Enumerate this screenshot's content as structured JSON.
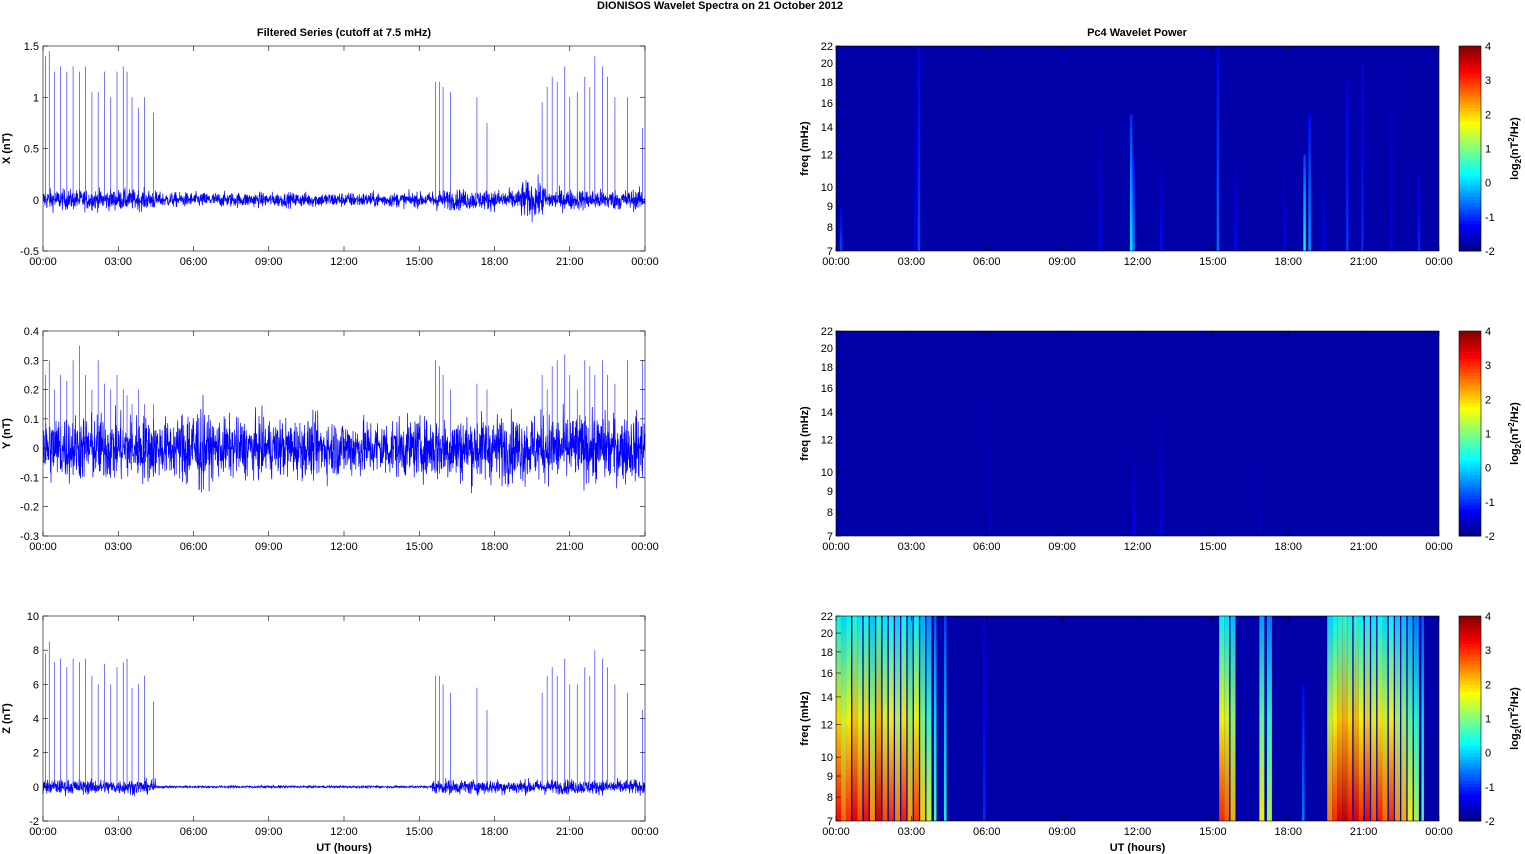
{
  "chart_data": {
    "title": "DIONISOS Wavelet Spectra on 21 October   2012",
    "left_title": "Filtered Series (cutoff at 7.5 mHz)",
    "right_title": "Pc4 Wavelet Power",
    "xlabel": "UT (hours)",
    "x_ticks": [
      "00:00",
      "03:00",
      "06:00",
      "09:00",
      "12:00",
      "15:00",
      "18:00",
      "21:00",
      "00:00"
    ],
    "xlim": [
      0,
      24
    ],
    "spike_times": [
      0.1,
      0.25,
      0.45,
      0.7,
      0.95,
      1.2,
      1.45,
      1.7,
      1.95,
      2.2,
      2.45,
      2.7,
      2.95,
      3.2,
      3.35,
      3.55,
      3.8,
      4.05,
      4.4,
      15.65,
      15.8,
      15.95,
      16.25,
      17.3,
      17.7,
      19.9,
      20.1,
      20.3,
      20.5,
      20.8,
      21.0,
      21.3,
      21.6,
      21.8,
      22.0,
      22.3,
      22.5,
      22.8,
      23.3,
      23.9
    ],
    "series": [
      {
        "type": "line",
        "name": "X",
        "ylabel": "X (nT)",
        "ylim": [
          -0.5,
          1.5
        ],
        "yticks": [
          "1.5",
          "1",
          "0.5",
          "0",
          "-0.5"
        ],
        "ytick_values": [
          1.5,
          1,
          0.5,
          0,
          -0.5
        ],
        "noise": 0.07,
        "quiet_noise": 0.05,
        "spike_amps": [
          1.4,
          1.45,
          1.25,
          1.3,
          1.25,
          1.3,
          1.25,
          1.3,
          1.05,
          1.05,
          1.25,
          1.0,
          1.25,
          1.3,
          1.25,
          1.0,
          0.9,
          1.0,
          0.85,
          1.15,
          1.15,
          1.1,
          1.05,
          1.0,
          0.75,
          0.95,
          1.1,
          1.2,
          1.15,
          1.3,
          1.0,
          1.05,
          1.2,
          1.1,
          1.4,
          1.3,
          1.2,
          1.0,
          1.0,
          0.7
        ]
      },
      {
        "type": "line",
        "name": "Y",
        "ylabel": "Y (nT)",
        "ylim": [
          -0.3,
          0.4
        ],
        "yticks": [
          "0.4",
          "0.3",
          "0.2",
          "0.1",
          "0",
          "-0.1",
          "-0.2",
          "-0.3"
        ],
        "ytick_values": [
          0.4,
          0.3,
          0.2,
          0.1,
          0,
          -0.1,
          -0.2,
          -0.3
        ],
        "noise": 0.08,
        "quiet_noise": 0.07,
        "spike_amps": [
          0.25,
          0.3,
          0.2,
          0.25,
          0.23,
          0.3,
          0.35,
          0.25,
          0.2,
          0.3,
          0.22,
          0.2,
          0.25,
          0.2,
          0.18,
          0.15,
          0.2,
          0.15,
          0.15,
          0.3,
          0.28,
          0.25,
          0.2,
          0.22,
          0.2,
          0.25,
          0.2,
          0.28,
          0.3,
          0.32,
          0.25,
          0.2,
          0.3,
          0.28,
          0.25,
          0.3,
          0.25,
          0.22,
          0.3,
          0.3
        ]
      },
      {
        "type": "line",
        "name": "Z",
        "ylabel": "Z (nT)",
        "ylim": [
          -2,
          10
        ],
        "yticks": [
          "10",
          "8",
          "6",
          "4",
          "2",
          "0",
          "-2"
        ],
        "ytick_values": [
          10,
          8,
          6,
          4,
          2,
          0,
          -2
        ],
        "noise": 0.3,
        "quiet_noise": 0.05,
        "spike_amps": [
          7.8,
          8.5,
          7.3,
          7.5,
          7.0,
          7.5,
          7.3,
          7.5,
          6.5,
          6.0,
          7.2,
          6.0,
          7.0,
          7.3,
          7.5,
          5.8,
          6.0,
          6.5,
          5.0,
          6.5,
          6.5,
          6.0,
          5.5,
          5.8,
          4.5,
          5.5,
          6.5,
          7.0,
          6.5,
          7.5,
          6.0,
          6.0,
          7.0,
          6.5,
          8.0,
          7.5,
          7.0,
          6.0,
          5.5,
          4.5
        ]
      }
    ],
    "spectra": [
      {
        "type": "heatmap",
        "ylabel": "freq (mHz)",
        "ylim": [
          7,
          22
        ],
        "yticks": [
          7,
          8,
          9,
          10,
          12,
          14,
          16,
          18,
          20,
          22
        ],
        "events": [
          [
            0.2,
            -0.8,
            9
          ],
          [
            3.3,
            -0.8,
            22
          ],
          [
            3.15,
            -1.4,
            22
          ],
          [
            10.5,
            -1.3,
            14
          ],
          [
            11.75,
            0.2,
            15
          ],
          [
            11.85,
            -0.6,
            12
          ],
          [
            12.95,
            -1.2,
            11
          ],
          [
            15.2,
            -0.6,
            22
          ],
          [
            15.9,
            -1.2,
            11
          ],
          [
            17.85,
            -1.3,
            11
          ],
          [
            18.65,
            0.4,
            12
          ],
          [
            18.85,
            -0.3,
            15
          ],
          [
            19.4,
            -1.3,
            11
          ],
          [
            20.35,
            -0.9,
            18
          ],
          [
            20.95,
            -1.0,
            20
          ],
          [
            22.1,
            -1.4,
            20
          ],
          [
            23.2,
            -1.0,
            11
          ]
        ]
      },
      {
        "type": "heatmap",
        "ylabel": "freq (mHz)",
        "ylim": [
          7,
          22
        ],
        "yticks": [
          7,
          8,
          9,
          10,
          12,
          14,
          16,
          18,
          20,
          22
        ],
        "events": [
          [
            6.1,
            -1.6,
            17
          ],
          [
            11.85,
            -1.3,
            11
          ],
          [
            12.95,
            -1.4,
            14
          ],
          [
            16.9,
            -1.6,
            11
          ]
        ]
      },
      {
        "type": "heatmap",
        "ylabel": "freq (mHz)",
        "ylim": [
          7,
          22
        ],
        "yticks": [
          7,
          8,
          9,
          10,
          12,
          14,
          16,
          18,
          20,
          22
        ],
        "events": [
          [
            0.1,
            3.2,
            22
          ],
          [
            0.3,
            2.6,
            22
          ],
          [
            0.5,
            3.0,
            22
          ],
          [
            0.75,
            3.4,
            22
          ],
          [
            0.95,
            2.8,
            22
          ],
          [
            1.2,
            3.2,
            22
          ],
          [
            1.45,
            2.4,
            22
          ],
          [
            1.7,
            3.5,
            22
          ],
          [
            1.95,
            2.8,
            22
          ],
          [
            2.2,
            3.0,
            22
          ],
          [
            2.45,
            2.5,
            22
          ],
          [
            2.7,
            3.1,
            22
          ],
          [
            2.95,
            2.3,
            22
          ],
          [
            3.2,
            2.9,
            22
          ],
          [
            3.45,
            2.0,
            22
          ],
          [
            3.7,
            1.5,
            22
          ],
          [
            3.95,
            0.8,
            22
          ],
          [
            4.35,
            0.5,
            22
          ],
          [
            5.9,
            -1.0,
            22
          ],
          [
            15.35,
            3.0,
            22
          ],
          [
            15.55,
            2.7,
            22
          ],
          [
            15.8,
            2.2,
            22
          ],
          [
            16.95,
            1.8,
            22
          ],
          [
            17.25,
            1.3,
            22
          ],
          [
            18.6,
            -0.5,
            15
          ],
          [
            19.65,
            2.5,
            22
          ],
          [
            19.85,
            3.0,
            22
          ],
          [
            20.05,
            3.4,
            22
          ],
          [
            20.25,
            3.6,
            22
          ],
          [
            20.45,
            3.2,
            22
          ],
          [
            20.7,
            3.5,
            22
          ],
          [
            20.9,
            3.0,
            22
          ],
          [
            21.15,
            3.3,
            22
          ],
          [
            21.4,
            2.8,
            22
          ],
          [
            21.65,
            3.1,
            22
          ],
          [
            21.85,
            2.6,
            22
          ],
          [
            22.1,
            3.0,
            22
          ],
          [
            22.35,
            2.4,
            22
          ],
          [
            22.6,
            2.2,
            22
          ],
          [
            22.85,
            1.8,
            22
          ],
          [
            23.1,
            1.3,
            22
          ],
          [
            23.35,
            0.8,
            22
          ]
        ]
      }
    ],
    "colorbar": {
      "label": "log2(nT2/Hz)",
      "ticks": [
        4,
        3,
        2,
        1,
        0,
        -1,
        -2
      ],
      "clim": [
        -2,
        4
      ]
    }
  }
}
